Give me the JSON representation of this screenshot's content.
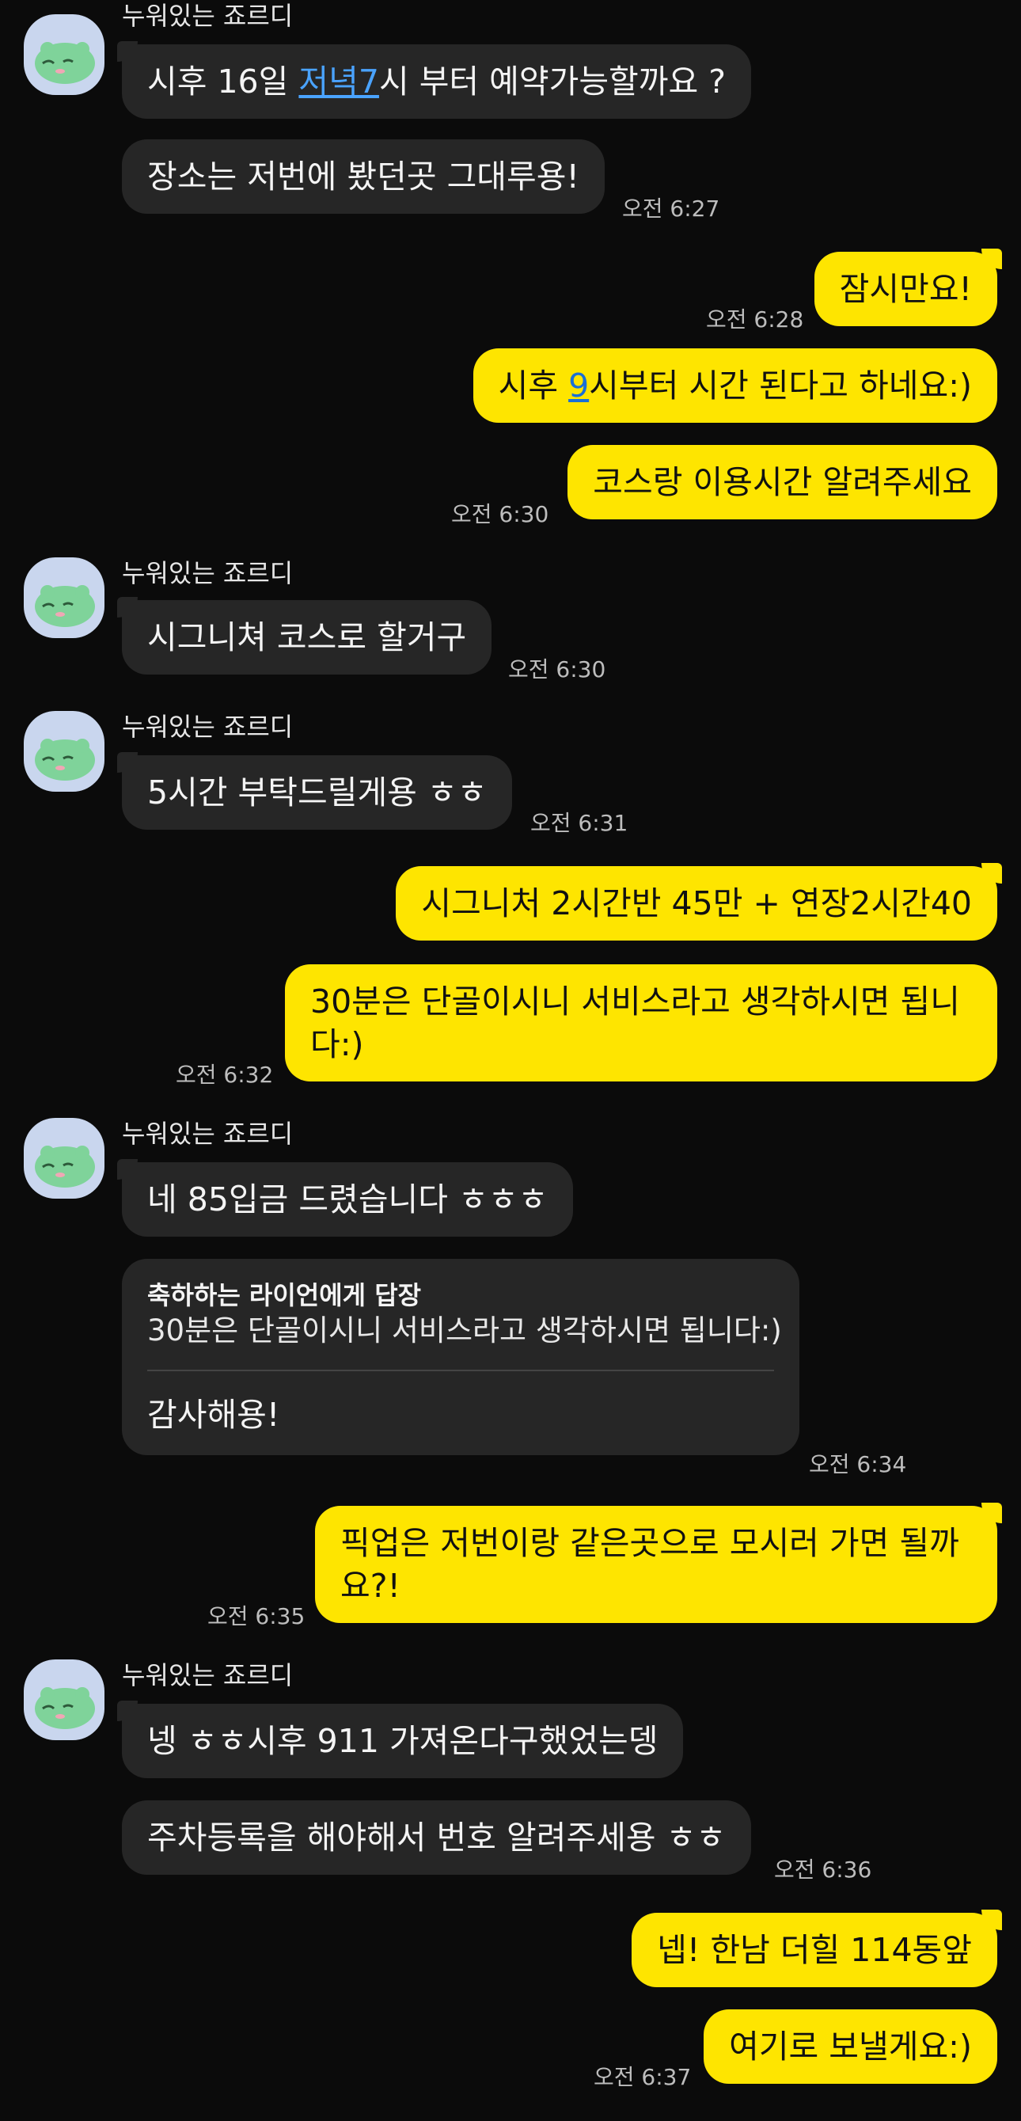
{
  "sender_name": "누워있는 죠르디",
  "colors": {
    "background": "#0b0b0b",
    "incoming_bubble": "#262626",
    "outgoing_bubble": "#fee500",
    "link": "#4aa3ff"
  },
  "messages": {
    "m1": {
      "before": "시후 16일 ",
      "link": "저녁7",
      "after": "시 부터 예약가능할까요 ?"
    },
    "m2": {
      "text": "장소는 저번에 봤던곳 그대루용!",
      "time": "오전 6:27"
    },
    "m3": {
      "text": "잠시만요!",
      "time": "오전 6:28"
    },
    "m4": {
      "before": "시후 ",
      "link": "9",
      "after": "시부터 시간 된다고 하네요:)"
    },
    "m5": {
      "text": "코스랑 이용시간 알려주세요",
      "time": "오전 6:30"
    },
    "m6": {
      "text": "시그니쳐 코스로 할거구",
      "time": "오전 6:30"
    },
    "m7": {
      "text": "5시간 부탁드릴게용 ㅎㅎ",
      "time": "오전 6:31"
    },
    "m8": {
      "text": "시그니처 2시간반 45만 + 연장2시간40"
    },
    "m9": {
      "text": "30분은 단골이시니 서비스라고 생각하시면 됩니다:)",
      "time": "오전 6:32"
    },
    "m10": {
      "text": "네 85입금 드렸습니다 ㅎㅎㅎ"
    },
    "m11": {
      "reply_title": "축하하는 라이언에게 답장",
      "reply_quote": "30분은 단골이시니 서비스라고 생각하시면 됩니다:)",
      "text": "감사해용!",
      "time": "오전 6:34"
    },
    "m12": {
      "text": "픽업은 저번이랑 같은곳으로 모시러 가면 될까요?!",
      "time": "오전 6:35"
    },
    "m13": {
      "text": "넹 ㅎㅎ시후 911 가져온다구했었는뎅"
    },
    "m14": {
      "text": "주차등록을 해야해서 번호 알려주세용 ㅎㅎ",
      "time": "오전 6:36"
    },
    "m15": {
      "text": "넵! 한남 더힐 114동앞"
    },
    "m16": {
      "text": "여기로 보낼게요:)",
      "time": "오전 6:37"
    }
  }
}
